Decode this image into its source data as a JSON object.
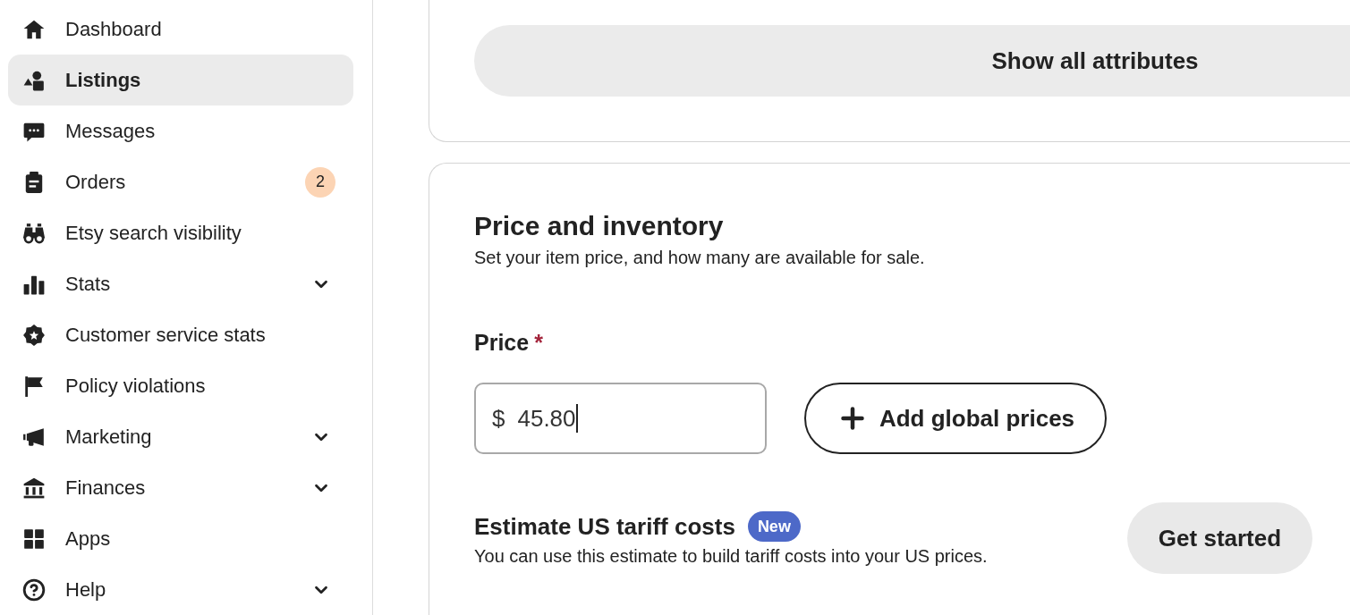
{
  "sidebar": {
    "items": [
      {
        "label": "Dashboard",
        "selected": false,
        "expandable": false
      },
      {
        "label": "Listings",
        "selected": true,
        "expandable": false
      },
      {
        "label": "Messages",
        "selected": false,
        "expandable": false
      },
      {
        "label": "Orders",
        "selected": false,
        "expandable": false,
        "badge": "2"
      },
      {
        "label": "Etsy search visibility",
        "selected": false,
        "expandable": false
      },
      {
        "label": "Stats",
        "selected": false,
        "expandable": true
      },
      {
        "label": "Customer service stats",
        "selected": false,
        "expandable": false
      },
      {
        "label": "Policy violations",
        "selected": false,
        "expandable": false
      },
      {
        "label": "Marketing",
        "selected": false,
        "expandable": true
      },
      {
        "label": "Finances",
        "selected": false,
        "expandable": true
      },
      {
        "label": "Apps",
        "selected": false,
        "expandable": false
      },
      {
        "label": "Help",
        "selected": false,
        "expandable": true
      }
    ]
  },
  "attributes_card": {
    "button": "Show all attributes"
  },
  "price_section": {
    "title": "Price and inventory",
    "subtitle": "Set your item price, and how many are available for sale.",
    "price_label": "Price",
    "required_mark": "*",
    "price_field": {
      "prefix": "$",
      "value": "45.80",
      "focused": true
    },
    "global_prices_button": "Add global prices",
    "tariff": {
      "title": "Estimate US tariff costs",
      "badge": "New",
      "description": "You can use this estimate to build tariff costs into your US prices.",
      "button": "Get started"
    }
  }
}
